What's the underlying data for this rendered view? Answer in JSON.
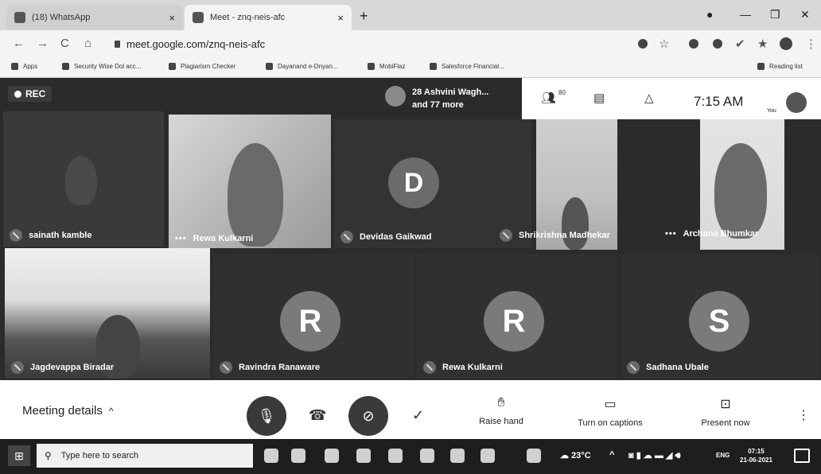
{
  "browser": {
    "tabs": [
      {
        "label": "(18) WhatsApp"
      },
      {
        "label": "Meet - znq-neis-afc"
      }
    ],
    "url": "meet.google.com/znq-neis-afc",
    "bookmarks": [
      "Apps",
      "Security Wise Dol acc...",
      "Plagiarism Checker",
      "Dayanand e-Dnyan...",
      "MobiFlaz",
      "Salesforce Financial...",
      "Reading list"
    ]
  },
  "meet": {
    "rec_label": "REC",
    "top_info": {
      "line1": "28 Ashvini Wagh...",
      "line2": "and 77 more"
    },
    "participants_count": "80",
    "time": "7:15 AM",
    "you_label": "You",
    "tiles": [
      {
        "name": "sainath kamble"
      },
      {
        "name": "Rewa Kulkarni"
      },
      {
        "name": "Devidas Gaikwad",
        "initial": "D"
      },
      {
        "name": "Shrikrishna Madhekar"
      },
      {
        "name": "Archana Bhumkar"
      },
      {
        "name": "Jagdevappa Biradar"
      },
      {
        "name": "Ravindra Ranaware",
        "initial": "R"
      },
      {
        "name": "Rewa Kulkarni",
        "initial": "R"
      },
      {
        "name": "Sadhana Ubale",
        "initial": "S"
      }
    ]
  },
  "controls": {
    "meeting_details": "Meeting details",
    "raise_hand": "Raise hand",
    "captions": "Turn on captions",
    "present": "Present now"
  },
  "taskbar": {
    "search_placeholder": "Type here to search",
    "weather": "23°C",
    "lang": "ENG",
    "time": "07:15",
    "date": "21-06-2021"
  }
}
